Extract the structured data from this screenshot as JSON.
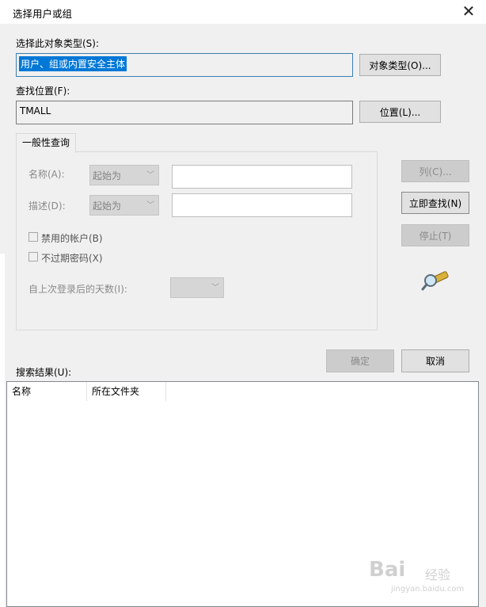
{
  "window": {
    "title": "选择用户或组"
  },
  "object_type": {
    "label": "选择此对象类型(S):",
    "value": "用户、组或内置安全主体",
    "button": "对象类型(O)..."
  },
  "location": {
    "label": "查找位置(F):",
    "value": "TMALL",
    "button": "位置(L)..."
  },
  "tab": {
    "label": "一般性查询"
  },
  "query": {
    "name_label": "名称(A):",
    "name_mode": "起始为",
    "desc_label": "描述(D):",
    "desc_mode": "起始为",
    "disabled_accounts": "禁用的帐户(B)",
    "non_expiring_pwd": "不过期密码(X)",
    "days_since_login": "自上次登录后的天数(I):"
  },
  "side_buttons": {
    "columns": "列(C)...",
    "find_now": "立即查找(N)",
    "stop": "停止(T)"
  },
  "dialog_buttons": {
    "ok": "确定",
    "cancel": "取消"
  },
  "results": {
    "label": "搜索结果(U):",
    "columns": [
      "名称",
      "所在文件夹"
    ]
  },
  "watermark": {
    "brand": "Bai",
    "brand2": "经验",
    "url": "jingyan.baidu.com"
  },
  "icons": {
    "search_flashlight": "flashlight-search-icon",
    "close": "close-icon",
    "dropdown": "chevron-down-icon"
  }
}
